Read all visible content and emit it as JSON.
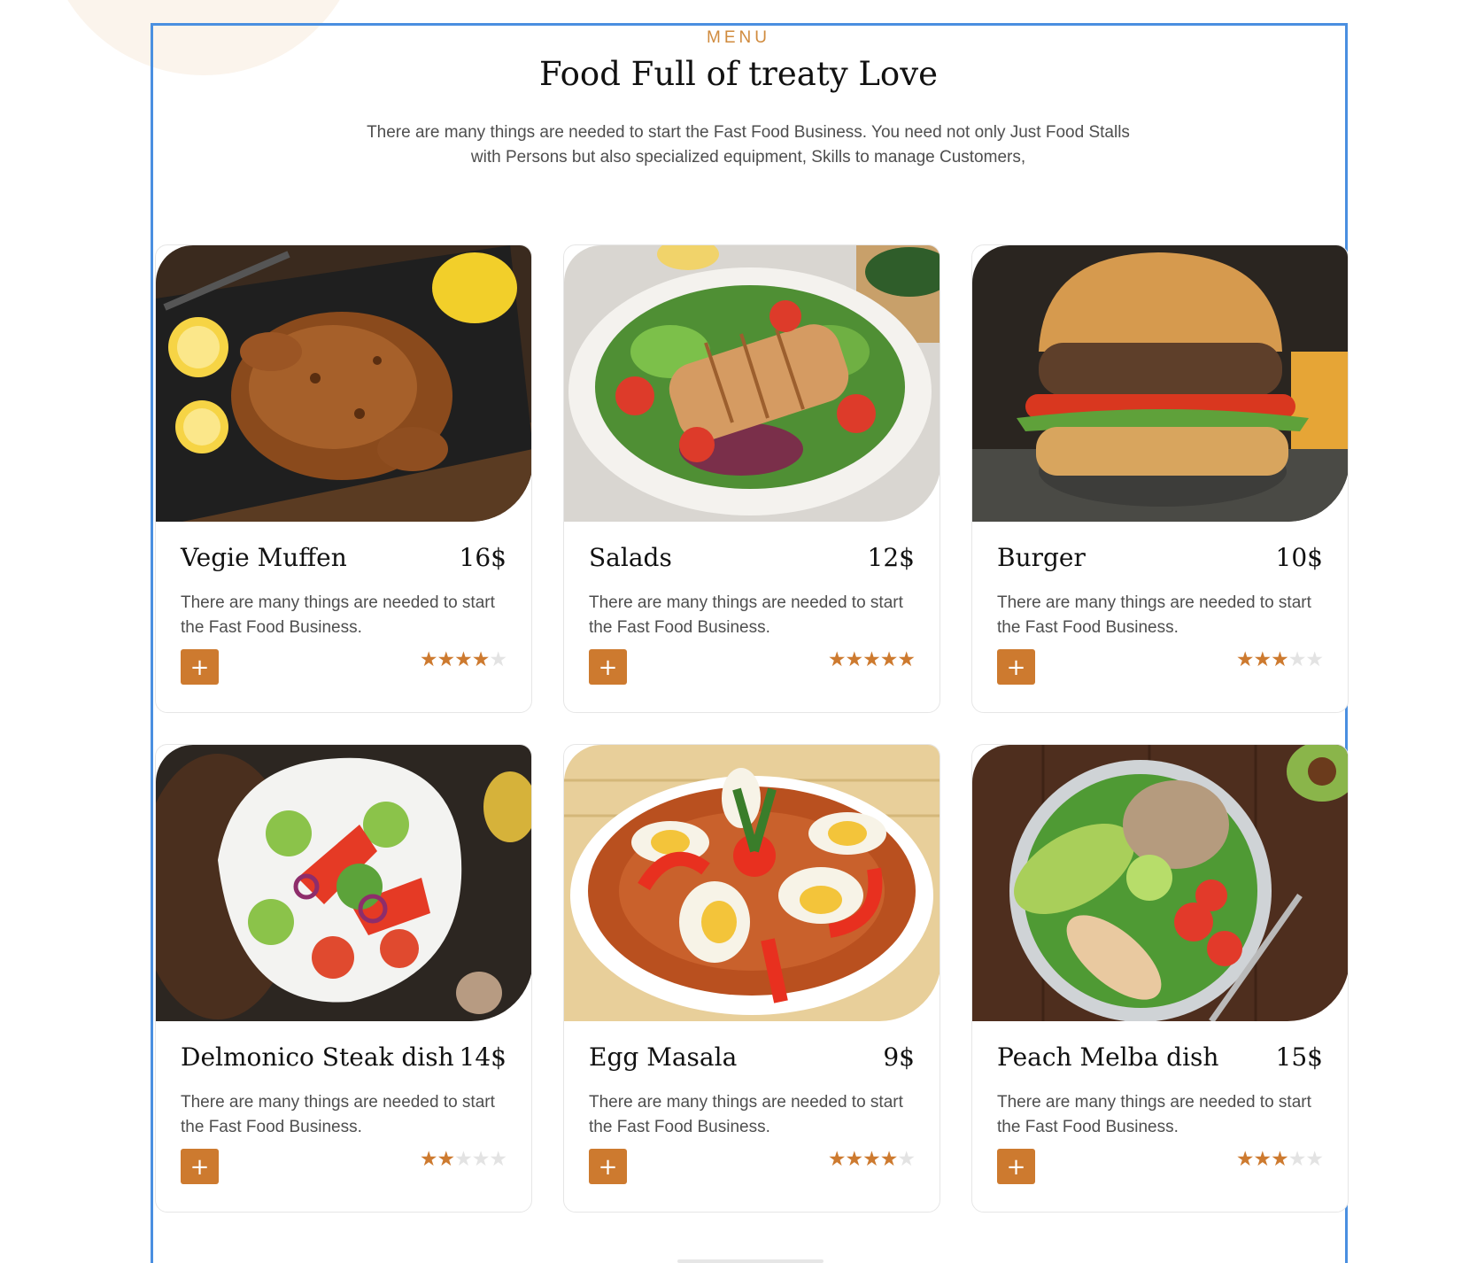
{
  "section": {
    "eyebrow": "MENU",
    "title": "Food Full of treaty Love",
    "subtitle": "There are many things are needed to start the Fast Food Business. You need not only Just Food Stalls with Persons but also specialized equipment, Skills to manage Customers,"
  },
  "colors": {
    "accent": "#cd7a2f",
    "frame": "#4a8fe0",
    "star_empty": "#e3e3e3"
  },
  "menu": {
    "items": [
      {
        "name": "Vegie Muffen",
        "price": "16$",
        "description": "There are many things are needed to start the Fast Food Business.",
        "rating": 4,
        "add_label": "+",
        "image": "roast-chicken-image"
      },
      {
        "name": "Salads",
        "price": "12$",
        "description": "There are many things are needed to start the Fast Food Business.",
        "rating": 5,
        "add_label": "+",
        "image": "chicken-salad-image"
      },
      {
        "name": "Burger",
        "price": "10$",
        "description": "There are many things are needed to start the Fast Food Business.",
        "rating": 3,
        "add_label": "+",
        "image": "burger-image"
      },
      {
        "name": "Delmonico Steak dish",
        "price": "14$",
        "description": "There are many things are needed to start the Fast Food Business.",
        "rating": 2,
        "add_label": "+",
        "image": "vegetable-salad-image"
      },
      {
        "name": "Egg Masala",
        "price": "9$",
        "description": "There are many things are needed to start the Fast Food Business.",
        "rating": 4,
        "add_label": "+",
        "image": "egg-masala-image"
      },
      {
        "name": "Peach Melba dish",
        "price": "15$",
        "description": "There are many things are needed to start the Fast Food Business.",
        "rating": 3,
        "add_label": "+",
        "image": "buddha-bowl-image"
      }
    ]
  }
}
